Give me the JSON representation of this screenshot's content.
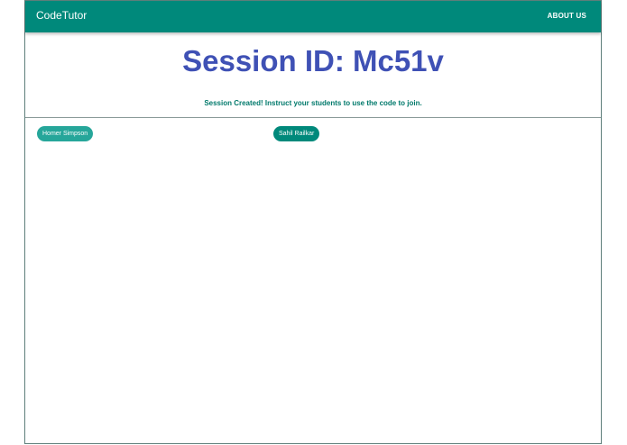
{
  "navbar": {
    "brand": "CodeTutor",
    "about_label": "ABOUT US"
  },
  "session": {
    "title": "Session ID: Mc51v",
    "message": "Session Created! Instruct your students to use the code to join."
  },
  "students": [
    {
      "name": "Homer Simpson"
    },
    {
      "name": "Sahil Railkar"
    }
  ],
  "colors": {
    "navbar": "#00897b",
    "title": "#3f51b5",
    "message": "#00796b",
    "chip_light": "#26a69a",
    "chip_dark": "#00897b"
  }
}
